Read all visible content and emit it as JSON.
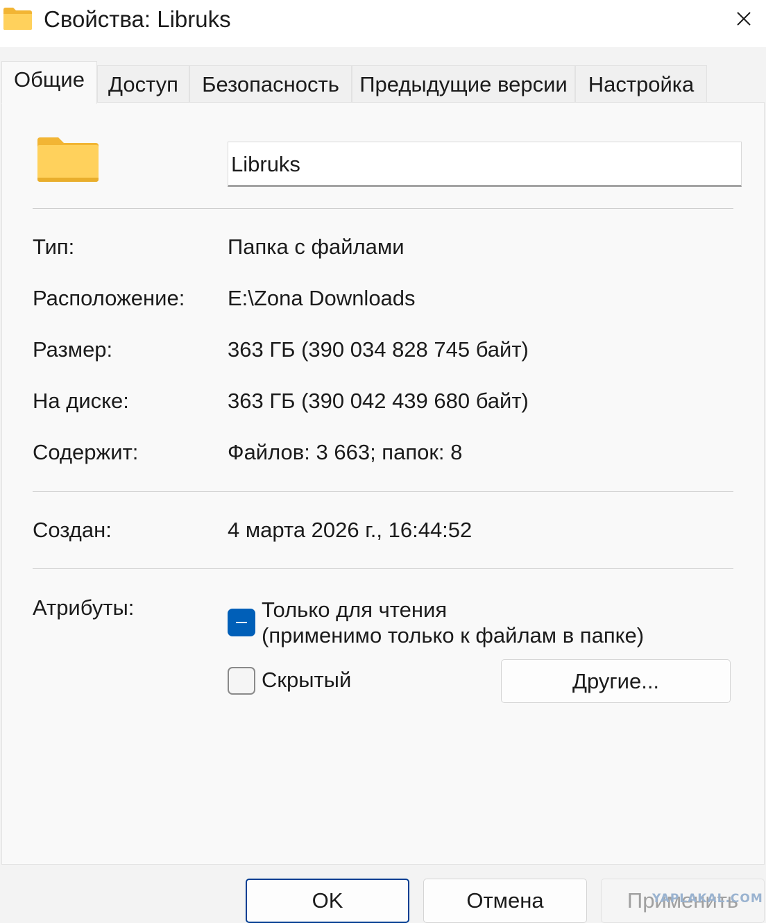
{
  "window": {
    "title": "Свойства: Libruks",
    "close_icon": "close-icon"
  },
  "tabs": [
    {
      "label": "Общие",
      "active": true
    },
    {
      "label": "Доступ",
      "active": false
    },
    {
      "label": "Безопасность",
      "active": false
    },
    {
      "label": "Предыдущие версии",
      "active": false
    },
    {
      "label": "Настройка",
      "active": false
    }
  ],
  "general": {
    "folder_icon": "folder-icon",
    "name_value": "Libruks",
    "rows": [
      {
        "label": "Тип:",
        "value": "Папка с файлами"
      },
      {
        "label": "Расположение:",
        "value": "E:\\Zona Downloads"
      },
      {
        "label": "Размер:",
        "value": "363 ГБ (390 034 828 745 байт)"
      },
      {
        "label": "На диске:",
        "value": "363 ГБ (390 042 439 680 байт)"
      },
      {
        "label": "Содержит:",
        "value": "Файлов: 3 663; папок: 8"
      }
    ],
    "created": {
      "label": "Создан:",
      "value": "4 марта 2026 г., 16:44:52"
    },
    "attributes": {
      "label": "Атрибуты:",
      "readonly_line1": "Только для чтения",
      "readonly_line2": "(применимо только к файлам в папке)",
      "readonly_state": "indeterminate",
      "hidden_label": "Скрытый",
      "hidden_state": "unchecked",
      "other_button": "Другие..."
    }
  },
  "footer": {
    "ok": "OK",
    "cancel": "Отмена",
    "apply": "Применить",
    "watermark": "YAPLAKAL.COM"
  },
  "colors": {
    "accent": "#005fb8",
    "folder_yellow": "#ffc83d"
  }
}
